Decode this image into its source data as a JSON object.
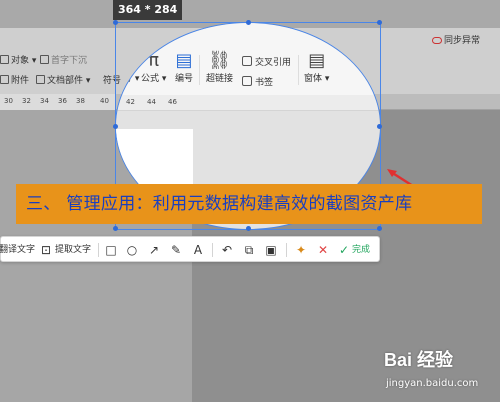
{
  "size_badge": "364 * 284",
  "ribbon": {
    "object": "对象",
    "first_sink": "首字下沉",
    "attachment": "附件",
    "doc_parts": "文档部件",
    "symbol": "符号",
    "formula": "公式",
    "numbering": "编号",
    "hyperlink": "超链接",
    "cross_ref": "交叉引用",
    "bookmark": "书签",
    "font_style": "窗体",
    "sync": "同步异常"
  },
  "ruler_numbers": [
    "30",
    "32",
    "34",
    "36",
    "38",
    "40",
    "42",
    "44",
    "46"
  ],
  "banner": "三、 管理应用：利用元数据构建高效的截图资产库",
  "toolbar": {
    "translate": "翻译文字",
    "extract": "提取文字",
    "done": "完成"
  },
  "watermark": {
    "main": "Bai 经验",
    "sub": "jingyan.baidu.com"
  },
  "colors": {
    "selection": "#4a86e8",
    "banner_bg": "#e8931a",
    "banner_text": "#1a3fbf",
    "done": "#21a55d",
    "cancel": "#e04343"
  },
  "icons": [
    "omega-icon",
    "pi-icon",
    "numbering-icon",
    "link-icon",
    "cross-ref-icon",
    "bookmark-icon",
    "form-icon",
    "rectangle-icon",
    "circle-icon",
    "arrow-icon",
    "pen-icon",
    "text-icon",
    "undo-icon",
    "copy-icon",
    "save-icon",
    "pin-icon",
    "close-icon",
    "check-icon"
  ]
}
